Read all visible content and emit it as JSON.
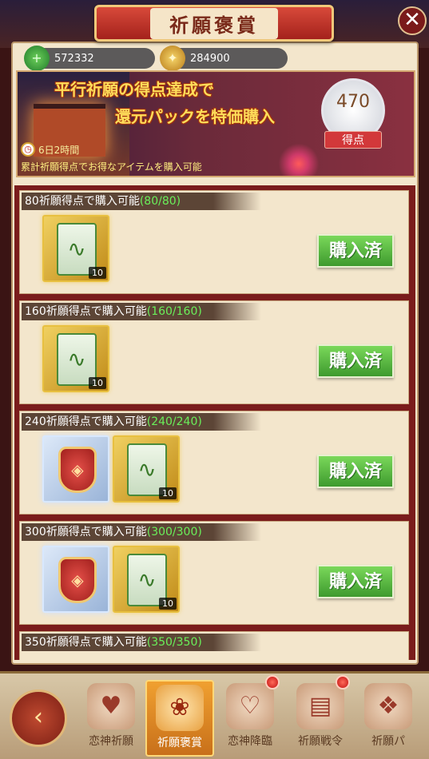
{
  "header": {
    "title": "祈願褒賞",
    "close_label": "✕"
  },
  "currencies": [
    {
      "icon": "green-gem-icon",
      "value": "572332"
    },
    {
      "icon": "gold-wings-icon",
      "value": "284900"
    }
  ],
  "promo": {
    "line1": "平行祈願の得点達成で",
    "line2": "還元パックを特価購入",
    "score": "470",
    "score_label": "得点",
    "timer": "6日2時間",
    "description": "累計祈願得点でお得なアイテムを購入可能"
  },
  "tiers": [
    {
      "label": "80祈願得点で購入可能",
      "progress": "(80/80)",
      "items": [
        {
          "type": "scroll",
          "qty": "10"
        }
      ],
      "button": "購入済"
    },
    {
      "label": "160祈願得点で購入可能",
      "progress": "(160/160)",
      "items": [
        {
          "type": "scroll",
          "qty": "10"
        }
      ],
      "button": "購入済"
    },
    {
      "label": "240祈願得点で購入可能",
      "progress": "(240/240)",
      "items": [
        {
          "type": "badge"
        },
        {
          "type": "scroll",
          "qty": "10"
        }
      ],
      "button": "購入済"
    },
    {
      "label": "300祈願得点で購入可能",
      "progress": "(300/300)",
      "items": [
        {
          "type": "badge"
        },
        {
          "type": "scroll",
          "qty": "10"
        }
      ],
      "button": "購入済"
    },
    {
      "label": "350祈願得点で購入可能",
      "progress": "(350/350)"
    }
  ],
  "nav": [
    {
      "label": "恋神祈願",
      "active": false,
      "dot": false
    },
    {
      "label": "祈願褒賞",
      "active": true,
      "dot": false
    },
    {
      "label": "恋神降臨",
      "active": false,
      "dot": true
    },
    {
      "label": "祈願戦令",
      "active": false,
      "dot": true
    },
    {
      "label": "祈願パ",
      "active": false,
      "dot": false
    }
  ],
  "colors": {
    "accent": "#c8701a",
    "progress": "#6aef5a",
    "buy_button": "#3e9a2e",
    "banner": "#a4221c"
  }
}
